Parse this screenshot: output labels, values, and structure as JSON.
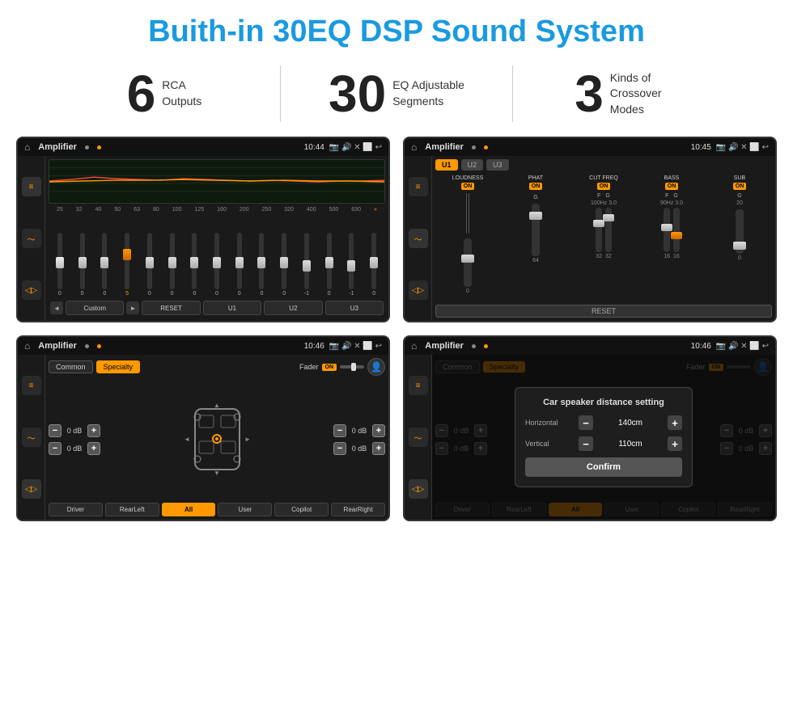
{
  "title": "Buith-in 30EQ DSP Sound System",
  "stats": [
    {
      "number": "6",
      "text": "RCA\nOutputs"
    },
    {
      "number": "30",
      "text": "EQ Adjustable\nSegments"
    },
    {
      "number": "3",
      "text": "Kinds of\nCrossover Modes"
    }
  ],
  "screen1": {
    "appTitle": "Amplifier",
    "time": "10:44",
    "eqBands": [
      "25",
      "32",
      "40",
      "50",
      "63",
      "80",
      "100",
      "125",
      "160",
      "200",
      "250",
      "320",
      "400",
      "500",
      "630"
    ],
    "eqValues": [
      "0",
      "0",
      "0",
      "5",
      "0",
      "0",
      "0",
      "0",
      "0",
      "0",
      "0",
      "-1",
      "0",
      "-1",
      "0"
    ],
    "preset": "Custom",
    "presets": [
      "◄",
      "Custom",
      "►",
      "RESET",
      "U1",
      "U2",
      "U3"
    ]
  },
  "screen2": {
    "appTitle": "Amplifier",
    "time": "10:45",
    "presets": [
      "U1",
      "U2",
      "U3"
    ],
    "channels": [
      "LOUDNESS",
      "PHAT",
      "CUT FREQ",
      "BASS",
      "SUB"
    ],
    "toggles": [
      "ON",
      "ON",
      "ON",
      "ON",
      "ON"
    ],
    "resetLabel": "RESET"
  },
  "screen3": {
    "appTitle": "Amplifier",
    "time": "10:46",
    "tabs": [
      "Common",
      "Specialty"
    ],
    "faderLabel": "Fader",
    "faderToggle": "ON",
    "zones": {
      "left": [
        {
          "label": "0 dB"
        },
        {
          "label": "0 dB"
        }
      ],
      "right": [
        {
          "label": "0 dB"
        },
        {
          "label": "0 dB"
        }
      ]
    },
    "buttons": [
      "Driver",
      "RearLeft",
      "All",
      "User",
      "Copilot",
      "RearRight"
    ]
  },
  "screen4": {
    "appTitle": "Amplifier",
    "time": "10:46",
    "tabs": [
      "Common",
      "Specialty"
    ],
    "dialog": {
      "title": "Car speaker distance setting",
      "horizontal": {
        "label": "Horizontal",
        "value": "140cm"
      },
      "vertical": {
        "label": "Vertical",
        "value": "110cm"
      },
      "confirm": "Confirm"
    },
    "zones": {
      "right": [
        {
          "label": "0 dB"
        },
        {
          "label": "0 dB"
        }
      ]
    },
    "buttons": [
      "Driver",
      "RearLeft",
      "All",
      "User",
      "Copilot",
      "RearRight"
    ]
  }
}
